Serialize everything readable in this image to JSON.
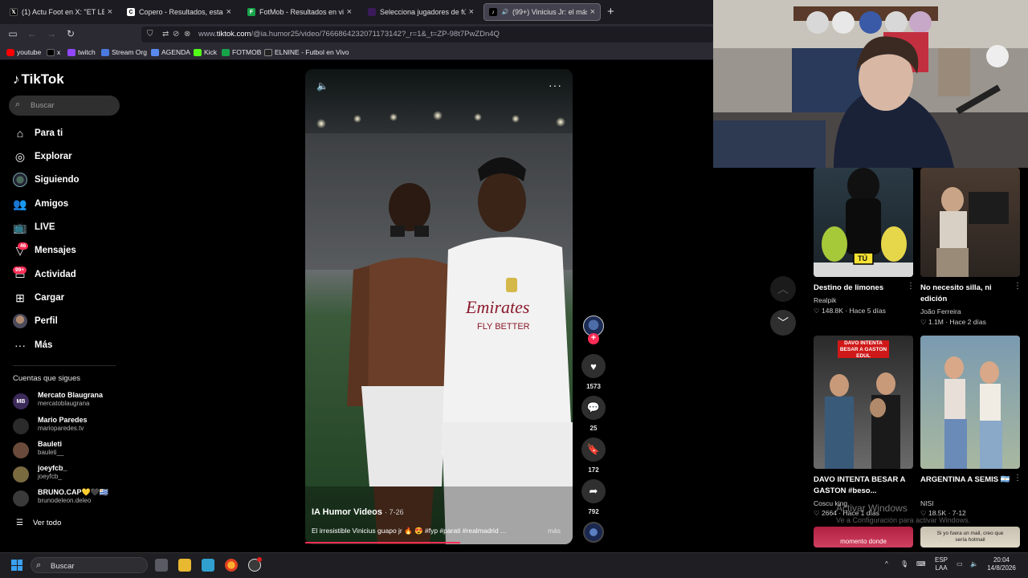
{
  "browser": {
    "tabs": [
      {
        "title": "(1) Actu Foot en X: \"ET LE PREM",
        "icon": "x-logo"
      },
      {
        "title": "Copero - Resultados, estadístic",
        "icon": "copero-logo"
      },
      {
        "title": "FotMob - Resultados en vivo de",
        "icon": "fotmob-logo"
      },
      {
        "title": "Selecciona jugadores de fútbol",
        "icon": "site-logo"
      },
      {
        "title": "(99+) Vinicius Jr: el más irre",
        "icon": "tiktok-logo"
      }
    ],
    "url_prefix": "www.",
    "url_domain": "tiktok.com",
    "url_path": "/@ia.humor25/video/7666864232071173142?_r=1&_t=ZP-98t7PwZDn4Q",
    "bookmarks": [
      "youtube",
      "x",
      "twitch",
      "Stream Org",
      "AGENDA",
      "Kick",
      "FOTMOB",
      "ELNINE - Futbol en Vivo"
    ]
  },
  "tiktok": {
    "logo_text": "TikTok",
    "search_placeholder": "Buscar",
    "nav": [
      {
        "label": "Para ti",
        "icon": "home-icon"
      },
      {
        "label": "Explorar",
        "icon": "compass-icon"
      },
      {
        "label": "Siguiendo",
        "icon": "following-avatar-icon"
      },
      {
        "label": "Amigos",
        "icon": "friends-icon"
      },
      {
        "label": "LIVE",
        "icon": "live-icon"
      },
      {
        "label": "Mensajes",
        "icon": "messages-icon",
        "badge": "46"
      },
      {
        "label": "Actividad",
        "icon": "activity-icon",
        "badge": "99+"
      },
      {
        "label": "Cargar",
        "icon": "upload-icon"
      },
      {
        "label": "Perfil",
        "icon": "profile-avatar-icon"
      },
      {
        "label": "Más",
        "icon": "more-icon"
      }
    ],
    "following_title": "Cuentas que sigues",
    "following": [
      {
        "name": "Mercato Blaugrana",
        "handle": "mercatoblaugrana",
        "avatar_color": "#3b2a5a"
      },
      {
        "name": "Mario Paredes",
        "handle": "marioparedes.tv",
        "avatar_color": "#2b2b2b"
      },
      {
        "name": "Bauleti",
        "handle": "bauleti__",
        "avatar_color": "#6a4a3a"
      },
      {
        "name": "joeyfcb_",
        "handle": "joeyfcb_",
        "avatar_color": "#7a6a40"
      },
      {
        "name": "BRUNO.CAP💛🖤🇺🇾",
        "handle": "brunodeleon.deleo",
        "avatar_color": "#3a3a3a"
      }
    ],
    "see_all": "Ver todo"
  },
  "video": {
    "author": "IA Humor Videos",
    "date": "· 7-26",
    "description": "El irresistible Vinicius guapo jr 🔥 😍 #fyp #parati  #realmadrid ...",
    "more": "más",
    "progress": 0.58,
    "jersey_text_1": "Emirates",
    "jersey_text_2": "FLY BETTER",
    "likes": "1573",
    "comments": "25",
    "saves": "172",
    "shares": "792"
  },
  "feed": [
    {
      "title": "Destino de limones",
      "author": "Realpik",
      "likes": "148.8K",
      "ago": "Hace 5 días",
      "overlay": "TÚ",
      "colors": [
        "#1e2a36",
        "#c9e25a"
      ]
    },
    {
      "title": "No necesito silla, ni edición",
      "author": "João Ferreira",
      "likes": "1.1M",
      "ago": "Hace 2 días",
      "overlay": "",
      "colors": [
        "#5a4a3a",
        "#d8c8b8"
      ]
    },
    {
      "title": "DAVO INTENTA BESAR A GASTON #beso...",
      "author": "Coscu king",
      "likes": "2664",
      "ago": "Hace 1 días",
      "overlay": "DAVO INTENTA BESAR A GASTON EDUL",
      "colors": [
        "#3a3a3a",
        "#a8a8a8"
      ]
    },
    {
      "title": "ARGENTINA A SEMIS 🇦🇷",
      "author": "NISI",
      "likes": "18.5K",
      "ago": "7-12",
      "overlay": "",
      "colors": [
        "#6a8aa0",
        "#e8d0b8"
      ]
    },
    {
      "title": "",
      "author": "",
      "likes": "",
      "ago": "",
      "overlay": "momento donde",
      "colors": [
        "#c0304a",
        "#e05070"
      ]
    },
    {
      "title": "",
      "author": "",
      "likes": "",
      "ago": "",
      "overlay": "Si yo fuera un mail, creo que sería hotmail",
      "colors": [
        "#c8c0b0",
        "#e8e0d0"
      ]
    }
  ],
  "windows": {
    "watermark_title": "Activar Windows",
    "watermark_sub": "Ve a Configuración para activar Windows.",
    "search": "Buscar",
    "lang": "ESP",
    "lang2": "LAA",
    "time": "20:04",
    "date": "14/8/2026"
  }
}
